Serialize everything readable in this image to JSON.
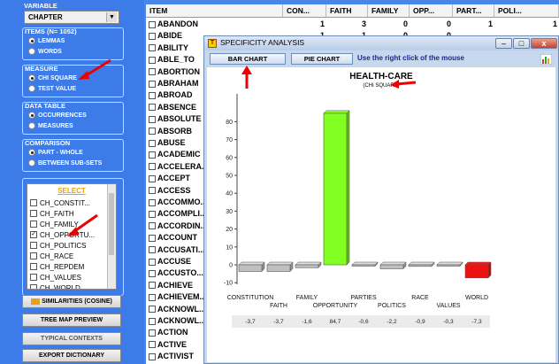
{
  "left_panel": {
    "variable": {
      "title": "VARIABLE",
      "selected": "CHAPTER"
    },
    "items": {
      "title": "ITEMS (N= 1052)",
      "options": [
        "LEMMAS",
        "WORDS"
      ],
      "selected": 0
    },
    "measure": {
      "title": "MEASURE",
      "options": [
        "CHI SQUARE",
        "TEST VALUE"
      ],
      "selected": 0
    },
    "data_table": {
      "title": "DATA TABLE",
      "options": [
        "OCCURRENCES",
        "MEASURES"
      ],
      "selected": 0
    },
    "comparison": {
      "title": "COMPARISON",
      "options": [
        "PART - WHOLE",
        "BETWEEN SUB-SETS"
      ],
      "selected": 0
    },
    "select": {
      "header": "SELECT",
      "items": [
        {
          "label": "CH_CONSTIT...",
          "checked": false
        },
        {
          "label": "CH_FAITH",
          "checked": false
        },
        {
          "label": "CH_FAMILY",
          "checked": false
        },
        {
          "label": "CH_OPPORTU...",
          "checked": true
        },
        {
          "label": "CH_POLITICS",
          "checked": false
        },
        {
          "label": "CH_RACE",
          "checked": false
        },
        {
          "label": "CH_REPDEM",
          "checked": false
        },
        {
          "label": "CH_VALUES",
          "checked": false
        },
        {
          "label": "CH_WORLD",
          "checked": false
        }
      ]
    },
    "buttons": {
      "similarities": "SIMILARITIES (COSINE)",
      "tree_map": "TREE MAP PREVIEW",
      "typical_contexts": "TYPICAL CONTEXTS",
      "export": "EXPORT DICTIONARY"
    }
  },
  "table": {
    "headers": [
      "ITEM",
      "CON...",
      "FAITH",
      "FAMILY",
      "OPP...",
      "PART...",
      "POLI..."
    ],
    "rows": [
      {
        "item": "ABANDON",
        "vals": [
          "1",
          "3",
          "0",
          "0",
          "1",
          "1"
        ]
      },
      {
        "item": "ABIDE",
        "vals": [
          "1",
          "1",
          "0",
          "0",
          "",
          ""
        ]
      },
      {
        "item": "ABILITY",
        "vals": [
          "",
          "",
          "",
          "",
          "",
          ""
        ]
      },
      {
        "item": "ABLE_TO",
        "vals": [
          "",
          "",
          "",
          "",
          "",
          ""
        ]
      },
      {
        "item": "ABORTION",
        "vals": [
          "",
          "",
          "",
          "",
          "",
          ""
        ]
      },
      {
        "item": "ABRAHAM",
        "vals": [
          "",
          "",
          "",
          "",
          "",
          ""
        ]
      },
      {
        "item": "ABROAD",
        "vals": [
          "",
          "",
          "",
          "",
          "",
          ""
        ]
      },
      {
        "item": "ABSENCE",
        "vals": [
          "",
          "",
          "",
          "",
          "",
          ""
        ]
      },
      {
        "item": "ABSOLUTE",
        "vals": [
          "",
          "",
          "",
          "",
          "",
          ""
        ]
      },
      {
        "item": "ABSORB",
        "vals": [
          "",
          "",
          "",
          "",
          "",
          ""
        ]
      },
      {
        "item": "ABUSE",
        "vals": [
          "",
          "",
          "",
          "",
          "",
          ""
        ]
      },
      {
        "item": "ACADEMIC",
        "vals": [
          "",
          "",
          "",
          "",
          "",
          ""
        ]
      },
      {
        "item": "ACCELERA...",
        "vals": [
          "",
          "",
          "",
          "",
          "",
          ""
        ]
      },
      {
        "item": "ACCEPT",
        "vals": [
          "",
          "",
          "",
          "",
          "",
          ""
        ]
      },
      {
        "item": "ACCESS",
        "vals": [
          "",
          "",
          "",
          "",
          "",
          ""
        ]
      },
      {
        "item": "ACCOMMO...",
        "vals": [
          "",
          "",
          "",
          "",
          "",
          ""
        ]
      },
      {
        "item": "ACCOMPLI...",
        "vals": [
          "",
          "",
          "",
          "",
          "",
          ""
        ]
      },
      {
        "item": "ACCORDIN...",
        "vals": [
          "",
          "",
          "",
          "",
          "",
          ""
        ]
      },
      {
        "item": "ACCOUNT",
        "vals": [
          "",
          "",
          "",
          "",
          "",
          ""
        ]
      },
      {
        "item": "ACCUSATI...",
        "vals": [
          "",
          "",
          "",
          "",
          "",
          ""
        ]
      },
      {
        "item": "ACCUSE",
        "vals": [
          "",
          "",
          "",
          "",
          "",
          ""
        ]
      },
      {
        "item": "ACCUSTO...",
        "vals": [
          "",
          "",
          "",
          "",
          "",
          ""
        ]
      },
      {
        "item": "ACHIEVE",
        "vals": [
          "",
          "",
          "",
          "",
          "",
          ""
        ]
      },
      {
        "item": "ACHIEVEM...",
        "vals": [
          "",
          "",
          "",
          "",
          "",
          ""
        ]
      },
      {
        "item": "ACKNOWL...",
        "vals": [
          "",
          "",
          "",
          "",
          "",
          ""
        ]
      },
      {
        "item": "ACKNOWL...",
        "vals": [
          "",
          "",
          "",
          "",
          "",
          ""
        ]
      },
      {
        "item": "ACTION",
        "vals": [
          "",
          "",
          "",
          "",
          "",
          ""
        ]
      },
      {
        "item": "ACTIVE",
        "vals": [
          "",
          "",
          "",
          "",
          "",
          ""
        ]
      },
      {
        "item": "ACTIVIST",
        "vals": [
          "",
          "",
          "",
          "",
          "",
          ""
        ]
      }
    ]
  },
  "window": {
    "title": "SPECIFICITY ANALYSIS",
    "bar_chart_btn": "BAR CHART",
    "pie_chart_btn": "PIE CHART",
    "hint": "Use the right click of the mouse",
    "controls": {
      "minimize": "–",
      "maximize": "□",
      "close": "x"
    }
  },
  "chart_data": {
    "type": "bar",
    "title": "HEALTH-CARE",
    "subtitle": "(CHI SQUARE)",
    "categories": [
      "CONSTITUTION",
      "FAITH",
      "FAMILY",
      "OPPORTUNITY",
      "PARTIES",
      "POLITICS",
      "RACE",
      "VALUES",
      "WORLD"
    ],
    "values": [
      -3.7,
      -3.7,
      -1.6,
      84.7,
      -0.6,
      -2.2,
      -0.9,
      -0.3,
      -7.3
    ],
    "value_labels": [
      "-3,7",
      "-3,7",
      "-1,6",
      "84,7",
      "-0,6",
      "-2,2",
      "-0,9",
      "-0,3",
      "-7,3"
    ],
    "colors": {
      "default": "#c0c0c0",
      "max": "#80ff20",
      "min": "#ee1111"
    },
    "ylim": [
      -10,
      90
    ],
    "yticks": [
      -10,
      0,
      10,
      20,
      30,
      40,
      50,
      60,
      70,
      80
    ],
    "grid": false
  }
}
